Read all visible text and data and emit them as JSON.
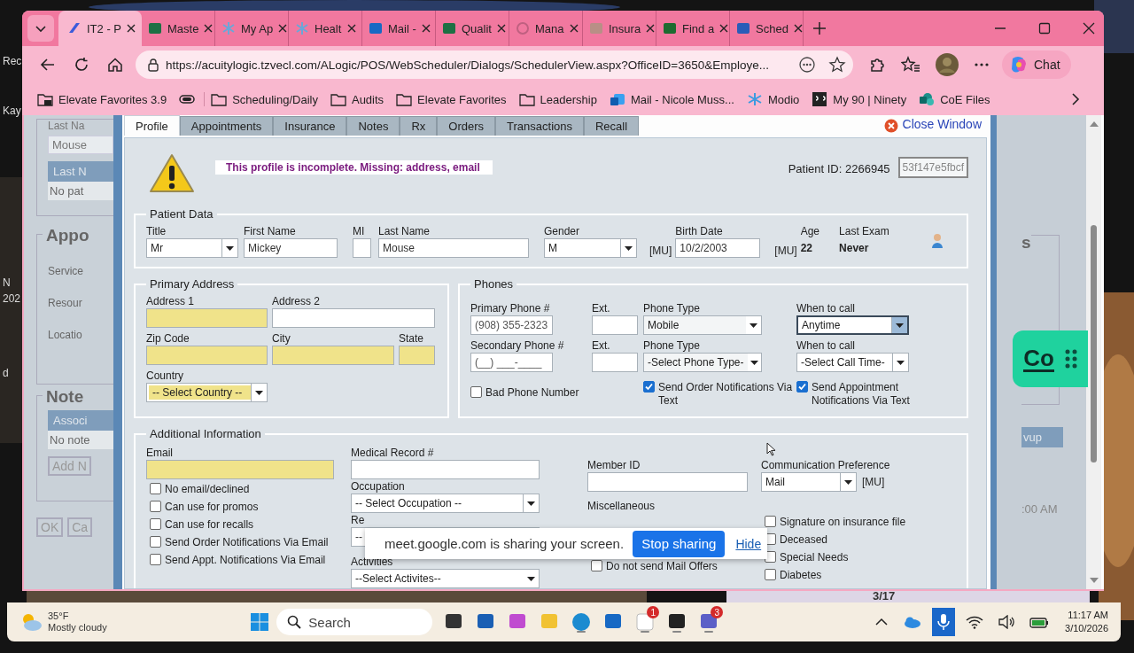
{
  "desktop": {
    "labels": [
      "Rec",
      "Kay",
      "N",
      "202",
      "d"
    ],
    "note": "3/17"
  },
  "browser": {
    "tabs": [
      {
        "label": "IT2 - P",
        "kind": "app",
        "selected": true
      },
      {
        "label": "Maste",
        "kind": "excel",
        "selected": false
      },
      {
        "label": "My Ap",
        "kind": "snow",
        "selected": false
      },
      {
        "label": "Healt",
        "kind": "snow",
        "selected": false
      },
      {
        "label": "Mail -",
        "kind": "outlook",
        "selected": false
      },
      {
        "label": "Qualit",
        "kind": "excel",
        "selected": false
      },
      {
        "label": "Mana",
        "kind": "headset",
        "selected": false
      },
      {
        "label": "Insura",
        "kind": "file",
        "selected": false
      },
      {
        "label": "Find a",
        "kind": "book",
        "selected": false
      },
      {
        "label": "Sched",
        "kind": "word",
        "selected": false
      }
    ],
    "address": "https://acuitylogic.tzvecl.com/ALogic/POS/WebScheduler/Dialogs/SchedulerView.aspx?OfficeID=3650&Employe...",
    "chat_button": "Chat",
    "bookmarks": [
      {
        "label": "Elevate Favorites 3.9",
        "kind": "bagfolder"
      },
      {
        "kind": "toggle"
      },
      {
        "label": "Scheduling/Daily",
        "kind": "folder"
      },
      {
        "label": "Audits",
        "kind": "folder"
      },
      {
        "label": "Elevate Favorites",
        "kind": "folder"
      },
      {
        "label": "Leadership",
        "kind": "folder"
      },
      {
        "label": "Mail - Nicole Muss...",
        "kind": "outlook"
      },
      {
        "label": "Modio",
        "kind": "snow"
      },
      {
        "label": "My 90 | Ninety",
        "kind": "ninety"
      },
      {
        "label": "CoE Files",
        "kind": "sharepoint"
      }
    ]
  },
  "background_left": {
    "last_name_label": "Last Na",
    "last_name_value": "Mouse",
    "header_1": "Last N",
    "empty_1": "No pat",
    "section_1": "Appo",
    "labels": [
      "Service",
      "Resour",
      "Locatio"
    ],
    "section_2": "Note",
    "header_2": "Associ",
    "empty_2": "No note",
    "add_button": "Add N",
    "ok_button": "OK",
    "cancel_button": "Ca"
  },
  "background_right": {
    "section": "s",
    "header": "vup",
    "time": ":00 AM"
  },
  "dialog": {
    "tabs": [
      {
        "label": "Profile",
        "selected": true
      },
      {
        "label": "Appointments",
        "selected": false
      },
      {
        "label": "Insurance",
        "selected": false
      },
      {
        "label": "Notes",
        "selected": false
      },
      {
        "label": "Rx",
        "selected": false
      },
      {
        "label": "Orders",
        "selected": false
      },
      {
        "label": "Transactions",
        "selected": false
      },
      {
        "label": "Recall",
        "selected": false
      }
    ],
    "close_link": "Close Window",
    "warning": "This profile is incomplete. Missing: address, email",
    "patient_id": "Patient ID: 2266945",
    "patient_key": "53f147e5fbcf",
    "patient_data": {
      "legend": "Patient Data",
      "title": {
        "label": "Title",
        "value": "Mr"
      },
      "first_name": {
        "label": "First Name",
        "value": "Mickey"
      },
      "mi": {
        "label": "MI"
      },
      "last_name": {
        "label": "Last Name",
        "value": "Mouse"
      },
      "gender": {
        "label": "Gender",
        "value": "M"
      },
      "mu_1": "[MU]",
      "birth_date": {
        "label": "Birth Date",
        "value": "10/2/2003"
      },
      "mu_2": "[MU]",
      "age": {
        "label": "Age",
        "value": "22"
      },
      "last_exam": {
        "label": "Last Exam",
        "value": "Never"
      }
    },
    "address": {
      "legend": "Primary Address",
      "fields": [
        {
          "label": "Address 1",
          "required": true
        },
        {
          "label": "Address 2",
          "required": false
        },
        {
          "label": "Zip Code",
          "required": true
        },
        {
          "label": "City",
          "required": true
        },
        {
          "label": "State",
          "required": true
        }
      ],
      "country": {
        "label": "Country",
        "value": "-- Select Country --",
        "required": true
      }
    },
    "phones": {
      "legend": "Phones",
      "rows": [
        {
          "phone": {
            "label": "Primary Phone #",
            "value": "(908) 355-2323"
          },
          "ext": {
            "label": "Ext."
          },
          "type": {
            "label": "Phone Type",
            "value": "Mobile"
          },
          "when": {
            "label": "When to call",
            "value": "Anytime",
            "focused": true
          }
        },
        {
          "phone": {
            "label": "Secondary Phone #",
            "value": "(__) ___-____"
          },
          "ext": {
            "label": "Ext."
          },
          "type": {
            "label": "Phone Type",
            "value": "-Select Phone Type-"
          },
          "when": {
            "label": "When to call",
            "value": "-Select Call Time-",
            "focused": false
          }
        }
      ],
      "checks": [
        {
          "label": "Bad Phone Number",
          "checked": false
        },
        {
          "label": "Send Order Notifications Via Text",
          "checked": true
        },
        {
          "label": "Send Appointment Notifications Via Text",
          "checked": true
        }
      ]
    },
    "additional": {
      "legend": "Additional Information",
      "email": {
        "label": "Email",
        "required": true
      },
      "email_checks": [
        {
          "label": "No email/declined",
          "checked": false
        },
        {
          "label": "Can use for promos",
          "checked": false
        },
        {
          "label": "Can use for recalls",
          "checked": false
        },
        {
          "label": "Send Order Notifications Via Email",
          "checked": false
        },
        {
          "label": "Send Appt. Notifications Via Email",
          "checked": false
        }
      ],
      "medical_record": {
        "label": "Medical Record #",
        "required": false
      },
      "occupation": {
        "label": "Occupation",
        "value": "-- Select Occupation --"
      },
      "referral": {
        "label": "Re",
        "value": "--"
      },
      "activities": {
        "label": "Activities",
        "value": "--Select Activites--"
      },
      "member_id": {
        "label": "Member ID",
        "required": false
      },
      "communication": {
        "label": "Communication Preference",
        "value": "Mail",
        "note": "[MU]"
      },
      "misc": {
        "label": "Miscellaneous",
        "column_1": [
          {
            "label": "Do not send Mail Offers",
            "checked": false
          }
        ],
        "column_2": [
          {
            "label": "Signature on insurance file",
            "checked": false
          },
          {
            "label": "Deceased",
            "checked": false
          },
          {
            "label": "Special Needs",
            "checked": false
          },
          {
            "label": "Diabetes",
            "checked": false
          }
        ]
      }
    }
  },
  "share_bar": {
    "message": "meet.google.com is sharing your screen.",
    "stop_button": "Stop sharing",
    "hide_link": "Hide"
  },
  "widget": {
    "label": "Co"
  },
  "taskbar": {
    "weather": {
      "temp": "35°F",
      "condition": "Mostly cloudy"
    },
    "search": "Search",
    "apps": [
      {
        "kind": "taskview",
        "running": false
      },
      {
        "kind": "store",
        "running": false
      },
      {
        "kind": "m365",
        "running": false
      },
      {
        "kind": "files",
        "running": false
      },
      {
        "kind": "edge",
        "running": true
      },
      {
        "kind": "outlook",
        "running": false
      },
      {
        "kind": "g",
        "running": true,
        "badge": "1"
      },
      {
        "kind": "sticky",
        "running": true
      },
      {
        "kind": "teams",
        "running": true,
        "badge": "3"
      }
    ],
    "time": "11:17 AM",
    "date": "3/10/2026"
  }
}
